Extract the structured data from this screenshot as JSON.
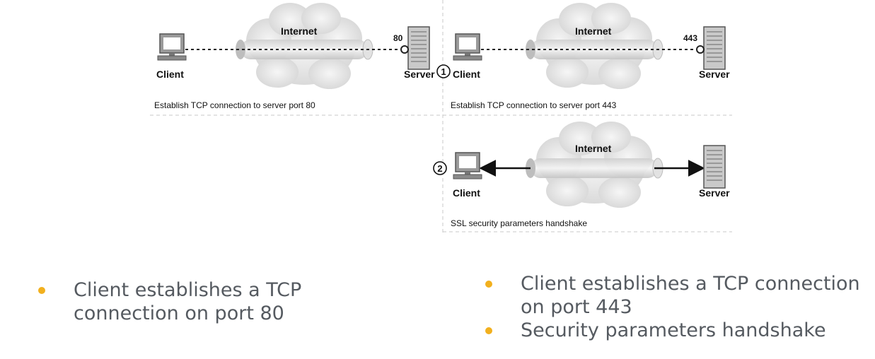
{
  "diagram": {
    "panel1": {
      "internet": "Internet",
      "client": "Client",
      "server": "Server",
      "port": "80",
      "caption": "Establish TCP connection to server port 80"
    },
    "panel2": {
      "step": "1",
      "internet": "Internet",
      "client": "Client",
      "server": "Server",
      "port": "443",
      "caption": "Establish TCP connection to server port 443"
    },
    "panel3": {
      "step": "2",
      "internet": "Internet",
      "client": "Client",
      "server": "Server",
      "caption": "SSL security parameters handshake"
    }
  },
  "bullets": {
    "left": [
      "Client establishes a TCP connection on port 80"
    ],
    "right": [
      "Client establishes a TCP connection on port 443",
      "Security parameters handshake"
    ]
  },
  "colors": {
    "bullet": "#f2b01e",
    "text": "#555a60"
  }
}
